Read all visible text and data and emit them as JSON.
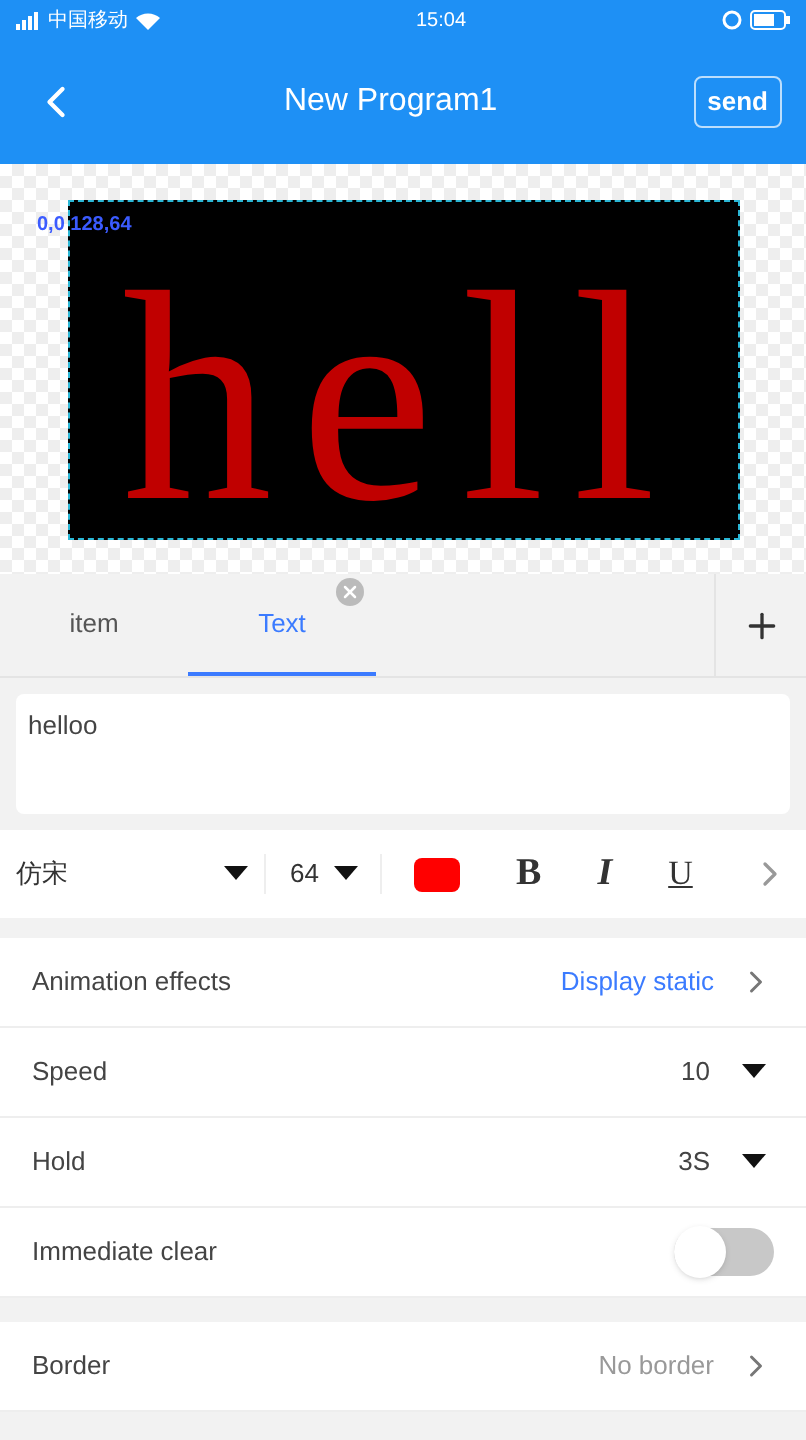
{
  "status_bar": {
    "carrier": "中国移动",
    "time": "15:04"
  },
  "header": {
    "title": "New Program1",
    "send": "send"
  },
  "preview": {
    "coords": "0,0 128,64",
    "display_text": "hell"
  },
  "tabs": [
    {
      "label": "item",
      "selected": false,
      "closable": false
    },
    {
      "label": "Text",
      "selected": true,
      "closable": true
    }
  ],
  "text_input": {
    "value": "helloo"
  },
  "toolbar": {
    "font": "仿宋",
    "size": "64",
    "color": "#ff0000",
    "bold": "B",
    "italic": "I",
    "underline": "U"
  },
  "settings": [
    {
      "kind": "link",
      "label": "Animation effects",
      "value": "Display static",
      "accent": true
    },
    {
      "kind": "dropdown",
      "label": "Speed",
      "value": "10"
    },
    {
      "kind": "dropdown",
      "label": "Hold",
      "value": "3S"
    },
    {
      "kind": "switch",
      "label": "Immediate clear",
      "on": false
    },
    {
      "kind": "link",
      "label": "Border",
      "value": "No border",
      "accent": false,
      "gap_before": true
    }
  ]
}
